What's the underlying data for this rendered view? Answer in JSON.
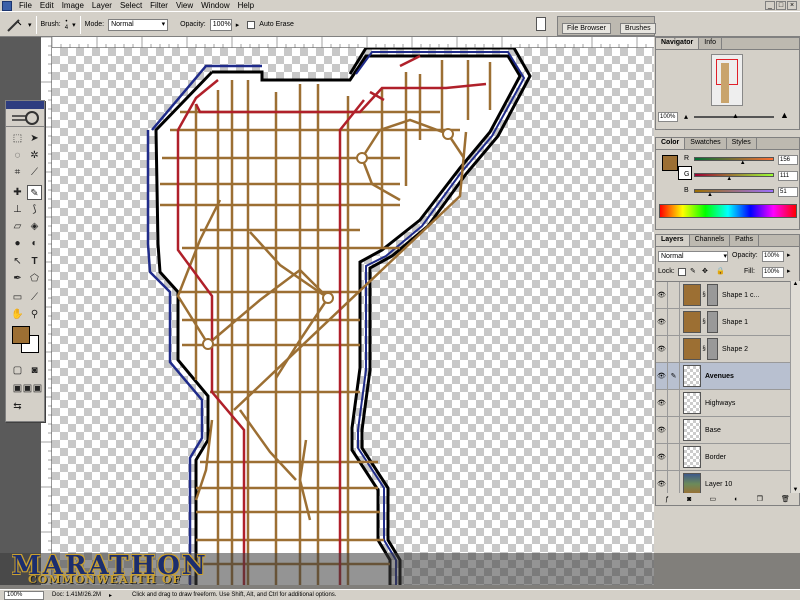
{
  "menu": [
    "File",
    "Edit",
    "Image",
    "Layer",
    "Select",
    "Filter",
    "View",
    "Window",
    "Help"
  ],
  "options_bar": {
    "brush_label": "Brush:",
    "brush_size": "4",
    "mode_label": "Mode:",
    "mode_value": "Normal",
    "opacity_label": "Opacity:",
    "opacity_value": "100%",
    "auto_erase_label": "Auto Erase"
  },
  "wells": {
    "file_browser": "File Browser",
    "brushes": "Brushes"
  },
  "navigator": {
    "tabs": [
      "Navigator",
      "Info"
    ],
    "zoom": "100%"
  },
  "color": {
    "tabs": [
      "Color",
      "Swatches",
      "Styles"
    ],
    "channels": [
      {
        "label": "R",
        "value": "156",
        "fraction": 0.61
      },
      {
        "label": "G",
        "value": "111",
        "fraction": 0.44
      },
      {
        "label": "B",
        "value": "51",
        "fraction": 0.2
      }
    ],
    "foreground_hex": "#9c6f33"
  },
  "layers": {
    "tabs": [
      "Layers",
      "Channels",
      "Paths"
    ],
    "blend_mode": "Normal",
    "opacity_label": "Opacity:",
    "opacity_value": "100%",
    "lock_label": "Lock:",
    "fill_label": "Fill:",
    "fill_value": "100%",
    "items": [
      {
        "name": "Shape 1 c...",
        "kind": "shape"
      },
      {
        "name": "Shape 1",
        "kind": "shape"
      },
      {
        "name": "Shape 2",
        "kind": "shape"
      },
      {
        "name": "Avenues",
        "kind": "raster",
        "selected": true
      },
      {
        "name": "Highways",
        "kind": "raster"
      },
      {
        "name": "Base",
        "kind": "raster"
      },
      {
        "name": "Border",
        "kind": "raster"
      },
      {
        "name": "Layer 10",
        "kind": "image"
      }
    ]
  },
  "status": {
    "zoom": "100%",
    "doc": "Doc: 1.41M/26.2M",
    "hint": "Click and drag to draw freeform. Use Shift, Alt, and Ctrl for additional options."
  },
  "watermark": {
    "title": "MARATHON",
    "subtitle": "COMMONWEALTH OF"
  },
  "colors": {
    "street": "#9c6f33",
    "highway": "#b0202a",
    "border_blue": "#1f2b8a",
    "border_black": "#000000"
  }
}
